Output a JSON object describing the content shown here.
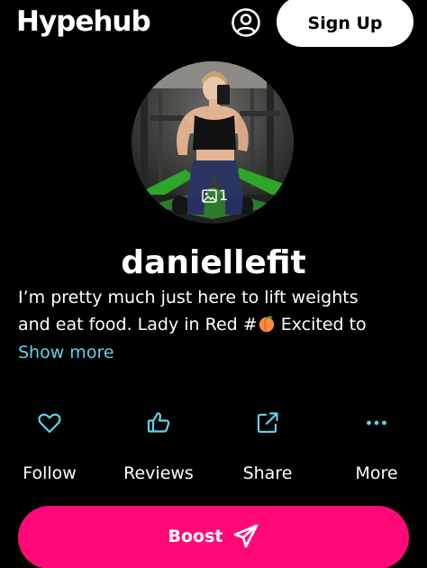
{
  "colors": {
    "background": "#000000",
    "accent_cyan": "#5fd3e8",
    "boost_pink": "#ff0a78",
    "white": "#ffffff"
  },
  "header": {
    "logo": "Hypehub",
    "account_icon": "user-circle-icon",
    "signup_label": "Sign Up"
  },
  "profile": {
    "photo_count": "1",
    "photo_icon": "image-icon",
    "username": "daniellefit",
    "bio_line1": "I’m pretty much just here to lift weights",
    "bio_line2_before": "and eat food. Lady in Red #",
    "bio_line2_after": " Excited to",
    "bio_emoji": "peach-emoji",
    "show_more": "Show more"
  },
  "actions": [
    {
      "label": "Follow",
      "icon": "heart-icon"
    },
    {
      "label": "Reviews",
      "icon": "thumbs-up-icon"
    },
    {
      "label": "Share",
      "icon": "share-icon"
    },
    {
      "label": "More",
      "icon": "more-dots-icon"
    }
  ],
  "boost": {
    "label": "Boost",
    "icon": "paper-plane-icon"
  }
}
